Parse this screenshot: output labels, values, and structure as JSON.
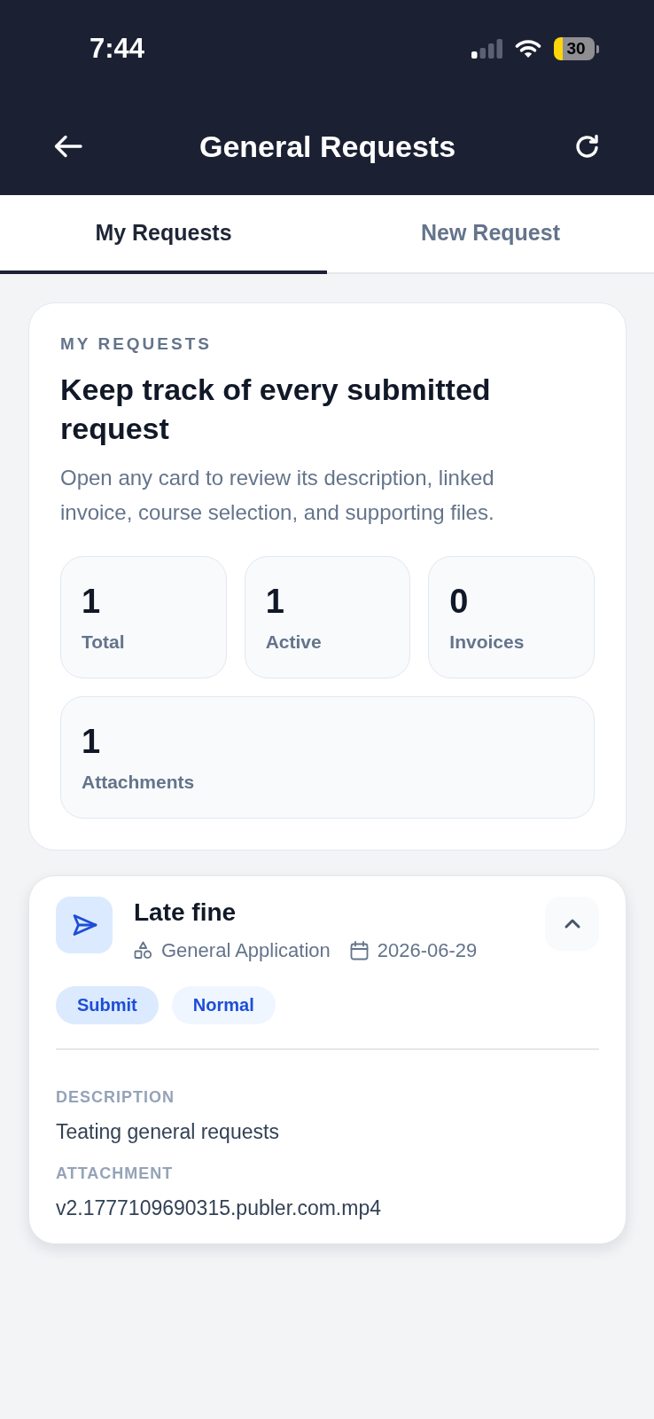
{
  "status_bar": {
    "time": "7:44",
    "battery": "30"
  },
  "header": {
    "title": "General Requests"
  },
  "tabs": [
    {
      "label": "My Requests",
      "selected": true
    },
    {
      "label": "New Request",
      "selected": false
    }
  ],
  "summary": {
    "eyebrow": "MY REQUESTS",
    "heading": "Keep track of every submitted request",
    "description": "Open any card to review its description, linked invoice, course selection, and supporting files.",
    "stats": [
      {
        "value": "1",
        "label": "Total"
      },
      {
        "value": "1",
        "label": "Active"
      },
      {
        "value": "0",
        "label": "Invoices"
      },
      {
        "value": "1",
        "label": "Attachments"
      }
    ]
  },
  "requests": [
    {
      "title": "Late fine",
      "category": "General Application",
      "date": "2026-06-29",
      "expanded": true,
      "tags": [
        {
          "label": "Submit",
          "kind": "status"
        },
        {
          "label": "Normal",
          "kind": "priority"
        }
      ],
      "details": [
        {
          "label": "DESCRIPTION",
          "value": "Teating general requests"
        },
        {
          "label": "ATTACHMENT",
          "value": "v2.1777109690315.publer.com.mp4"
        }
      ]
    }
  ]
}
